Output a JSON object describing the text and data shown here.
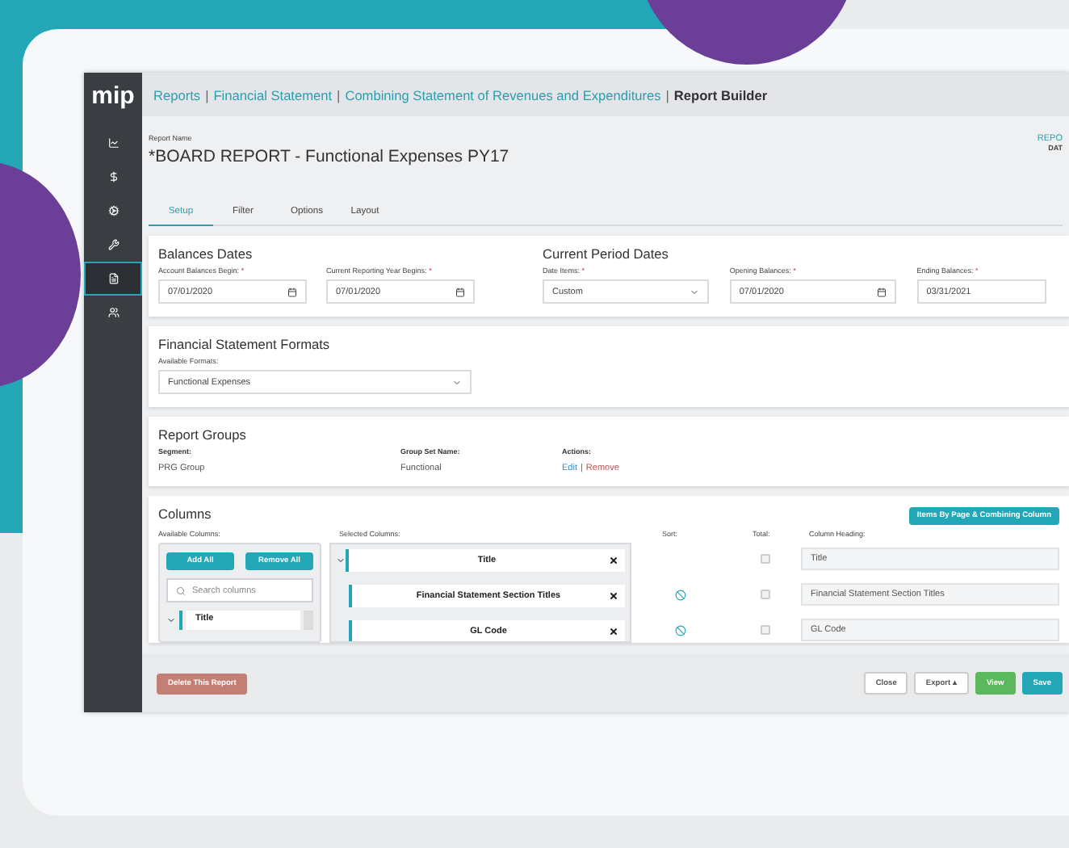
{
  "breadcrumb": {
    "separator": "|",
    "items": [
      {
        "label": "Reports",
        "current": false
      },
      {
        "label": "Financial Statement",
        "current": false
      },
      {
        "label": "Combining Statement of Revenues and Expenditures",
        "current": false
      },
      {
        "label": "Report Builder",
        "current": true
      }
    ]
  },
  "sidebar": {
    "logo": "mip",
    "items": [
      {
        "selected": false
      },
      {
        "selected": false
      },
      {
        "selected": false
      },
      {
        "selected": false
      },
      {
        "selected": true
      },
      {
        "selected": false
      }
    ]
  },
  "report": {
    "name_label": "Report Name",
    "name": "*BOARD REPORT - Functional Expenses PY17",
    "right_label": "REPO",
    "right_sub": "DAT"
  },
  "tabs": [
    {
      "label": "Setup",
      "selected": true
    },
    {
      "label": "Filter",
      "selected": false
    },
    {
      "label": "Options",
      "selected": false
    },
    {
      "label": "Layout",
      "selected": false
    }
  ],
  "balances": {
    "title": "Balances Dates",
    "fields": [
      {
        "label": "Account Balances Begin:",
        "required": "*",
        "kind": "date",
        "value": "07/01/2020"
      },
      {
        "label": "Current Reporting Year Begins:",
        "required": "*",
        "kind": "date",
        "value": "07/01/2020"
      }
    ]
  },
  "period": {
    "title": "Current Period Dates",
    "fields": [
      {
        "label": "Date Items:",
        "required": "*",
        "kind": "select",
        "value": "Custom"
      },
      {
        "label": "Opening Balances:",
        "required": "*",
        "kind": "date",
        "value": "07/01/2020"
      },
      {
        "label": "Ending Balances:",
        "required": "*",
        "kind": "text",
        "value": "03/31/2021"
      }
    ]
  },
  "formats": {
    "title": "Financial Statement Formats",
    "label": "Available Formats:",
    "value": "Functional Expenses"
  },
  "groups": {
    "title": "Report Groups",
    "segment_label": "Segment:",
    "segment": "PRG Group",
    "set_label": "Group Set Name:",
    "set": "Functional",
    "actions_label": "Actions:",
    "edit": "Edit",
    "action_separator": "|",
    "remove": "Remove"
  },
  "columns": {
    "title": "Columns",
    "top_button": "Items By Page & Combining Column",
    "available_label": "Available Columns:",
    "selected_label": "Selected Columns:",
    "sort_label": "Sort:",
    "total_label": "Total:",
    "heading_label": "Column Heading:",
    "add_all": "Add All",
    "remove_all": "Remove All",
    "search_placeholder": "Search columns",
    "available": [
      {
        "label": "Title",
        "expanded": true
      }
    ],
    "selected": [
      {
        "label": "Title",
        "expanded": true,
        "sort": false,
        "total": false,
        "heading": "Title"
      },
      {
        "label": "Financial Statement Section Titles",
        "sort": true,
        "total": false,
        "heading": "Financial Statement Section Titles"
      },
      {
        "label": "GL Code",
        "sort": true,
        "total": false,
        "heading": "GL Code"
      }
    ]
  },
  "footer": {
    "delete": "Delete This Report",
    "buttons": [
      {
        "label": "Close",
        "kind": "plain"
      },
      {
        "label": "Export ▴",
        "kind": "plain"
      },
      {
        "label": "View",
        "kind": "green"
      },
      {
        "label": "Save",
        "kind": "teal"
      }
    ]
  }
}
